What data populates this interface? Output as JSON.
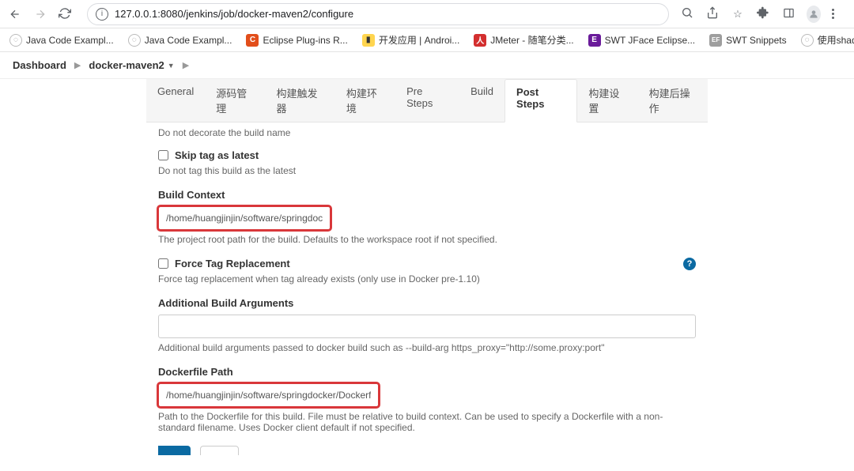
{
  "browser": {
    "url": "127.0.0.1:8080/jenkins/job/docker-maven2/configure",
    "bookmarks": [
      {
        "icon": "globe",
        "label": "Java Code Exampl..."
      },
      {
        "icon": "globe",
        "label": "Java Code Exampl..."
      },
      {
        "icon": "orange",
        "glyph": "C",
        "label": "Eclipse Plug-ins R..."
      },
      {
        "icon": "yellow",
        "glyph": "▮",
        "label": "开发应用 | Androi..."
      },
      {
        "icon": "red",
        "glyph": "人",
        "label": "JMeter - 随笔分类..."
      },
      {
        "icon": "purple",
        "glyph": "E",
        "label": "SWT JFace Eclipse..."
      },
      {
        "icon": "gray",
        "glyph": "EF",
        "label": "SWT Snippets"
      },
      {
        "icon": "globe",
        "label": "使用shadowsocks..."
      }
    ]
  },
  "breadcrumb": {
    "root": "Dashboard",
    "job": "docker-maven2"
  },
  "tabs": [
    {
      "label": "General",
      "active": false
    },
    {
      "label": "源码管理",
      "active": false
    },
    {
      "label": "构建触发器",
      "active": false
    },
    {
      "label": "构建环境",
      "active": false
    },
    {
      "label": "Pre Steps",
      "active": false
    },
    {
      "label": "Build",
      "active": false
    },
    {
      "label": "Post Steps",
      "active": true
    },
    {
      "label": "构建设置",
      "active": false
    },
    {
      "label": "构建后操作",
      "active": false
    }
  ],
  "form": {
    "skipDecorateHelp": "Do not decorate the build name",
    "skipTag": {
      "label": "Skip tag as latest",
      "help": "Do not tag this build as the latest"
    },
    "buildContext": {
      "label": "Build Context",
      "value": "/home/huangjinjin/software/springdocker",
      "help": "The project root path for the build. Defaults to the workspace root if not specified."
    },
    "forceTag": {
      "label": "Force Tag Replacement",
      "help": "Force tag replacement when tag already exists (only use in Docker pre-1.10)"
    },
    "addArgs": {
      "label": "Additional Build Arguments",
      "value": "",
      "help": "Additional build arguments passed to docker build such as --build-arg https_proxy=\"http://some.proxy:port\""
    },
    "dockerfile": {
      "label": "Dockerfile Path",
      "value": "/home/huangjinjin/software/springdocker/Dockerfile",
      "help": "Path to the Dockerfile for this build. File must be relative to build context. Can be used to specify a Dockerfile with a non-standard filename. Uses Docker client default if not specified."
    }
  }
}
